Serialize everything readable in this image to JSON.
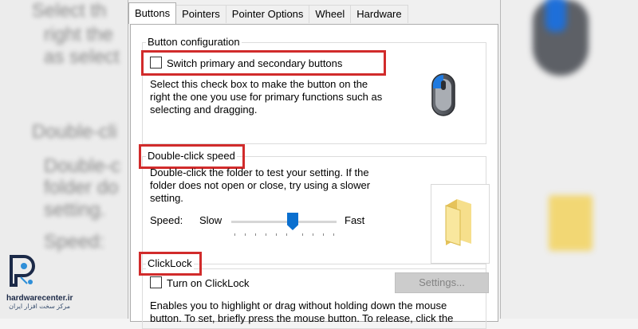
{
  "dialog": {
    "tabs": [
      {
        "label": "Buttons",
        "active": true
      },
      {
        "label": "Pointers"
      },
      {
        "label": "Pointer Options"
      },
      {
        "label": "Wheel"
      },
      {
        "label": "Hardware"
      }
    ],
    "button_configuration": {
      "title": "Button configuration",
      "checkbox_label": "Switch primary and secondary buttons",
      "checked": false,
      "description": "Select this check box to make the button on the right the one you use for primary functions such as selecting and dragging.",
      "icon": "mouse-icon"
    },
    "double_click": {
      "title": "Double-click speed",
      "description": "Double-click the folder to test your setting. If the folder does not open or close, try using a slower setting.",
      "speed_label": "Speed:",
      "slow_label": "Slow",
      "fast_label": "Fast",
      "slider_value": 0.55,
      "icon": "folder-icon"
    },
    "clicklock": {
      "title": "ClickLock",
      "checkbox_label": "Turn on ClickLock",
      "checked": false,
      "settings_button": "Settings...",
      "description": "Enables you to highlight or drag without holding down the mouse button. To set, briefly press the mouse button. To release, click the"
    }
  },
  "highlight_color": "#d12b2b",
  "accent_color": "#0a6fcf",
  "watermark": {
    "site": "hardwarecenter.ir",
    "tagline": "مرکز سخت افزار ایران"
  },
  "background_ghost_text": [
    "Select th",
    "right the",
    "as select",
    "Double-cli",
    "Double-c",
    "folder do",
    "setting.",
    "Speed:"
  ]
}
